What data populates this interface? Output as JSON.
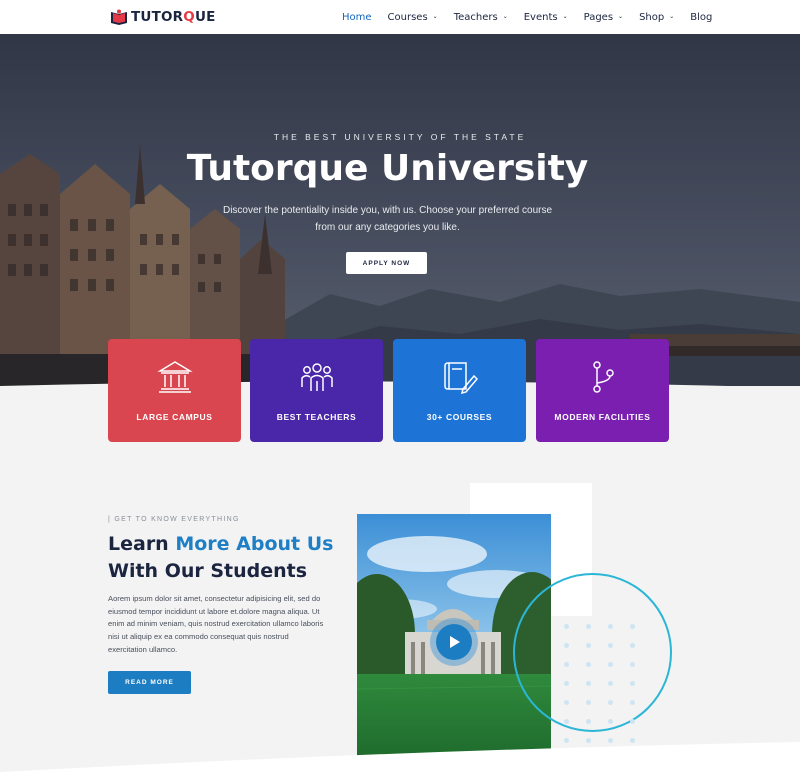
{
  "brand": {
    "name_pre": "TUTOR",
    "name_o": "Q",
    "name_post": "UE"
  },
  "nav": {
    "items": [
      {
        "label": "Home",
        "dropdown": false,
        "active": true
      },
      {
        "label": "Courses",
        "dropdown": true,
        "active": false
      },
      {
        "label": "Teachers",
        "dropdown": true,
        "active": false
      },
      {
        "label": "Events",
        "dropdown": true,
        "active": false
      },
      {
        "label": "Pages",
        "dropdown": true,
        "active": false
      },
      {
        "label": "Shop",
        "dropdown": true,
        "active": false
      },
      {
        "label": "Blog",
        "dropdown": false,
        "active": false
      }
    ],
    "chevron": "⌄"
  },
  "hero": {
    "kicker": "THE BEST UNIVERSITY OF THE STATE",
    "title": "Tutorque University",
    "description": "Discover the potentiality inside you, with us. Choose your preferred course from our any categories  you like.",
    "cta": "APPLY NOW"
  },
  "features": [
    {
      "label": "LARGE CAMPUS",
      "icon": "building-columns-icon",
      "color": "#d9464f"
    },
    {
      "label": "BEST TEACHERS",
      "icon": "people-group-icon",
      "color": "#4a26a8"
    },
    {
      "label": "30+ COURSES",
      "icon": "book-pen-icon",
      "color": "#1e74d6"
    },
    {
      "label": "MODERN FACILITIES",
      "icon": "git-branch-icon",
      "color": "#7b1fb0"
    }
  ],
  "about": {
    "kicker": "| GET TO KNOW EVERYTHING",
    "title_part1": "Learn ",
    "title_accent": "More About Us",
    "title_line2": "With Our Students",
    "text": "Aorem ipsum dolor sit amet, consectetur adipisicing elit, sed do eiusmod tempor incididunt ut labore et.dolore magna aliqua. Ut enim ad minim veniam, quis nostrud exercitation ullamco laboris nisi ut aliquip ex ea commodo consequat quis nostrud exercitation ullamco.",
    "cta": "READ MORE"
  },
  "video": {
    "play_icon": "play-icon"
  }
}
